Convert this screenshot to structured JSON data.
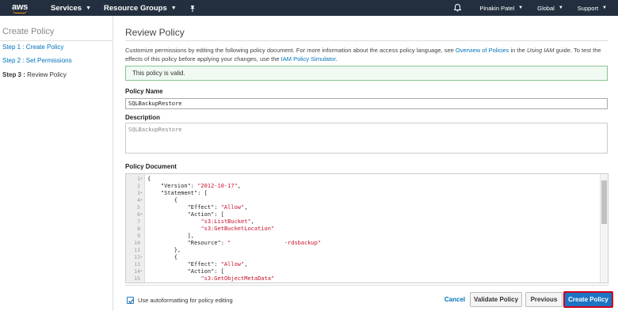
{
  "nav": {
    "logo": "aws",
    "services": "Services",
    "resource_groups": "Resource Groups",
    "pin_icon": "pin-icon",
    "bell_icon": "bell-icon",
    "user": "Pinakin Patel",
    "region": "Global",
    "support": "Support"
  },
  "sidebar": {
    "title": "Create Policy",
    "steps": [
      {
        "label": "Step 1 : Create Policy"
      },
      {
        "label": "Step 2 : Set Permissions"
      },
      {
        "prefix": "Step 3 :",
        "label": " Review Policy"
      }
    ]
  },
  "main": {
    "title": "Review Policy",
    "desc_1": "Customize permissions by editing the following policy document. For more information about the access policy language, see ",
    "desc_link1": "Overview of Policies",
    "desc_2": " in the ",
    "desc_italic": "Using IAM",
    "desc_3": " guide. To test the effects of this policy before applying your changes, use the ",
    "desc_link2": "IAM Policy Simulator",
    "desc_4": ".",
    "valid_msg": "This policy is valid.",
    "name_label": "Policy Name",
    "name_value": "SQLBackupRestore",
    "description_label": "Description",
    "description_value": "SQLBackupRestore",
    "doc_label": "Policy Document",
    "code_lines": [
      {
        "n": "1",
        "fold": true,
        "t": "{"
      },
      {
        "n": "2",
        "fold": false,
        "t": "    \"Version\": ",
        "s": "\"2012-10-17\"",
        "e": ","
      },
      {
        "n": "3",
        "fold": true,
        "t": "    \"Statement\": ["
      },
      {
        "n": "4",
        "fold": true,
        "t": "        {"
      },
      {
        "n": "5",
        "fold": false,
        "t": "            \"Effect\": ",
        "s": "\"Allow\"",
        "e": ","
      },
      {
        "n": "6",
        "fold": true,
        "t": "            \"Action\": ["
      },
      {
        "n": "7",
        "fold": false,
        "t": "                ",
        "s": "\"s3:ListBucket\"",
        "e": ","
      },
      {
        "n": "8",
        "fold": false,
        "t": "                ",
        "s": "\"s3:GetBucketLocation\"",
        "e": ""
      },
      {
        "n": "9",
        "fold": false,
        "t": "            ],"
      },
      {
        "n": "10",
        "fold": false,
        "t": "            \"Resource\": ",
        "s": "\"                -rdsbackup\"",
        "e": ""
      },
      {
        "n": "11",
        "fold": false,
        "t": "        },"
      },
      {
        "n": "12",
        "fold": true,
        "t": "        {"
      },
      {
        "n": "13",
        "fold": false,
        "t": "            \"Effect\": ",
        "s": "\"Allow\"",
        "e": ","
      },
      {
        "n": "14",
        "fold": true,
        "t": "            \"Action\": ["
      },
      {
        "n": "15",
        "fold": false,
        "t": "                ",
        "s": "\"s3:GetObjectMetaData\"",
        "e": ""
      }
    ],
    "autoformat_label": "Use autoformatting for policy editing",
    "autoformat_checked": true,
    "cancel": "Cancel",
    "validate": "Validate Policy",
    "previous": "Previous",
    "create": "Create Policy"
  },
  "colors": {
    "nav_bg": "#232f3e",
    "link": "#0073bb",
    "primary": "#1d74c4",
    "highlight_border": "#d0021b",
    "success_bg": "#f0faf2",
    "string": "#c8102e"
  }
}
